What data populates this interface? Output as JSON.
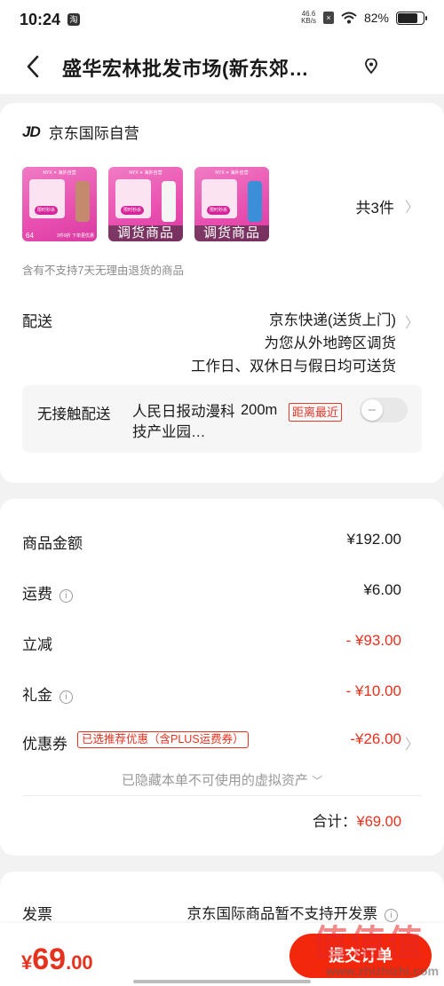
{
  "status_bar": {
    "time": "10:24",
    "app_icon": "淘",
    "net_speed_value": "46.6",
    "net_speed_unit": "KB/s",
    "battery": "82%",
    "battery_level": 0.82
  },
  "header": {
    "title": "盛华宏林批发市场(新东郊…"
  },
  "shop": {
    "logo": "JD",
    "name": "京东国际自营"
  },
  "products": {
    "items": [
      {
        "tag": "",
        "price": "64",
        "note": "3件9折 下单更优惠",
        "color": "#c48a6e"
      },
      {
        "tag": "调货商品",
        "color": "#f5f5f5"
      },
      {
        "tag": "调货商品",
        "color": "#3b8fd8"
      }
    ],
    "flash_label": "限时秒杀",
    "count": "共3件",
    "notice": "含有不支持7天无理由退货的商品"
  },
  "shipping": {
    "label": "配送",
    "method": "京东快递(送货上门)",
    "transfer_note": "为您从外地跨区调货",
    "delivery_days": "工作日、双休日与假日均可送货"
  },
  "contactless": {
    "label": "无接触配送",
    "place": "人民日报动漫科技产业园…",
    "distance": "200m",
    "badge": "距离最近",
    "enabled": false
  },
  "amounts": {
    "goods_label": "商品金额",
    "goods_value": "¥192.00",
    "freight_label": "运费",
    "freight_value": "¥6.00",
    "discount_label": "立减",
    "discount_value": "- ¥93.00",
    "gift_label": "礼金",
    "gift_value": "- ¥10.00",
    "coupon_label": "优惠券",
    "coupon_badge": "已选推荐优惠（含PLUS运费券）",
    "coupon_value": "-¥26.00",
    "hidden_assets": "已隐藏本单不可使用的虚拟资产",
    "total_label": "合计：",
    "total_value": "¥69.00"
  },
  "invoice": {
    "label": "发票",
    "value": "京东国际商品暂不支持开发票"
  },
  "bottom": {
    "currency": "¥",
    "price_int": "69",
    "price_dec": ".00",
    "submit": "提交订单"
  },
  "watermark": {
    "logo": "值值值",
    "url": "www.zhizhizhi.com"
  },
  "colors": {
    "accent": "#e5321f",
    "submit": "#f2270c",
    "thumb_pink": "#e84fb0"
  }
}
